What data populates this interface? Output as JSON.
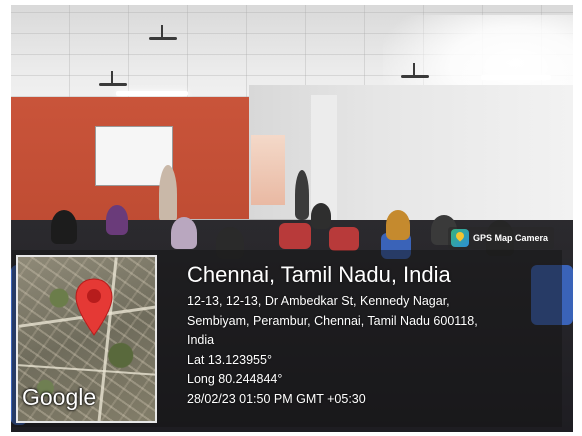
{
  "stamp": {
    "brand_label": "GPS Map Camera",
    "brand_icon": "gps-map-camera-icon",
    "map_logo": "Google",
    "pin_icon": "map-pin-icon",
    "pin_color": "#e53935",
    "location_title": "Chennai, Tamil Nadu, India",
    "address_lines": [
      "12-13, 12-13, Dr Ambedkar St, Kennedy Nagar,",
      "Sembiyam, Perambur, Chennai, Tamil Nadu 600118,",
      "India"
    ],
    "latitude": "Lat 13.123955°",
    "longitude": "Long 80.244844°",
    "datetime": "28/02/23 01:50 PM GMT +05:30"
  }
}
